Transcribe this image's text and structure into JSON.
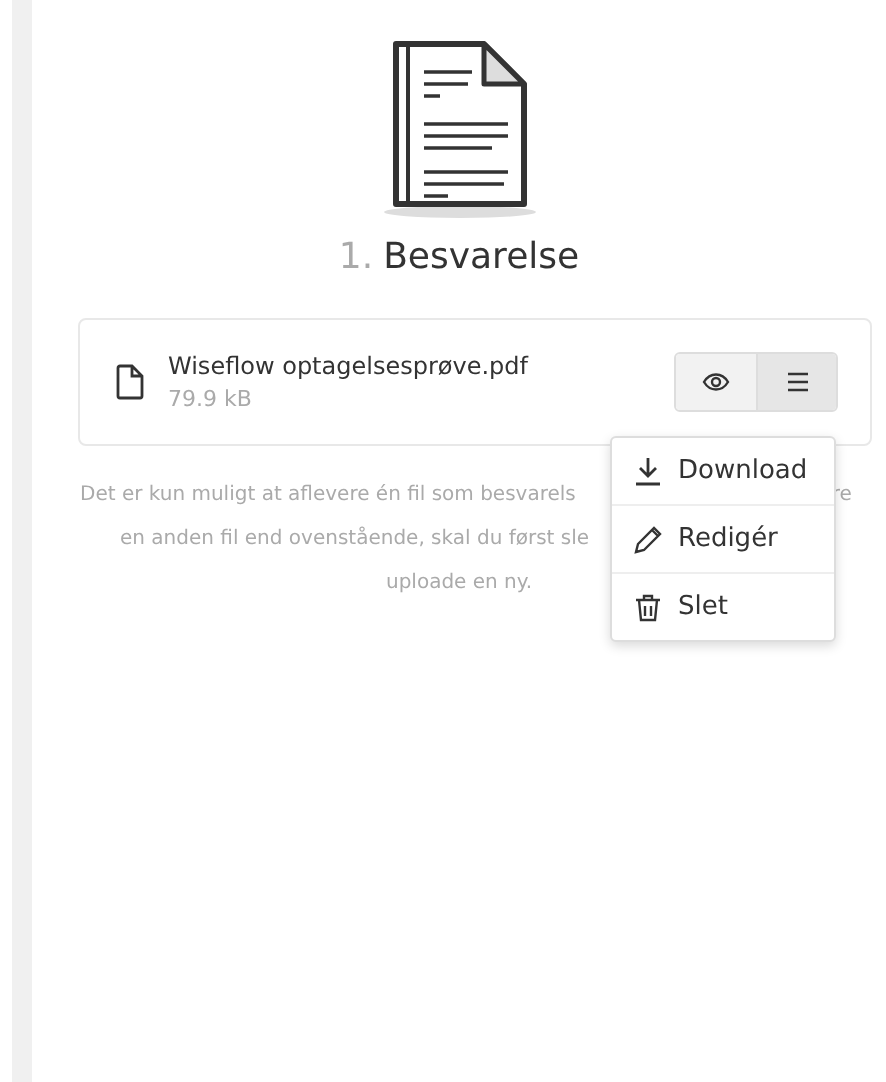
{
  "section": {
    "number": "1.",
    "title": "Besvarelse"
  },
  "file": {
    "name": "Wiseflow optagelsesprøve.pdf",
    "size": "79.9 kB"
  },
  "menu": {
    "expanded": true,
    "items": [
      {
        "kind": "download",
        "label": "Download"
      },
      {
        "kind": "edit",
        "label": "Redigér"
      },
      {
        "kind": "delete",
        "label": "Slet"
      }
    ]
  },
  "note": {
    "lines": [
      [
        "Det er kun muligt at aflevere én fil som besvarels",
        "re"
      ],
      [
        "en anden fil end ovenstående, skal du først sle"
      ],
      [
        "uploade en ny."
      ]
    ]
  }
}
